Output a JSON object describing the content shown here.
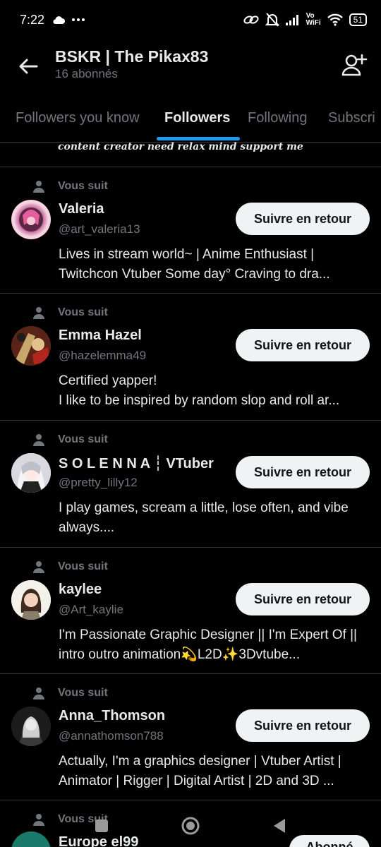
{
  "status_bar": {
    "time": "7:22",
    "vowifi_top": "Vo",
    "vowifi_bottom": "WiFi",
    "battery": "51"
  },
  "header": {
    "title": "BSKR | The Pikax83",
    "subtitle": "16 abonnés"
  },
  "tabs": [
    {
      "label": "Followers you know"
    },
    {
      "label": "Followers"
    },
    {
      "label": "Following"
    },
    {
      "label": "Subscri"
    }
  ],
  "partial_bio": "content creator need relax mind support me",
  "followers": [
    {
      "follows_label": "Vous suit",
      "name": "Valeria",
      "handle": "@art_valeria13",
      "bio": "Lives in stream world~ | Anime Enthusiast | Twitchcon  Vtuber Some day° Craving to dra...",
      "button": "Suivre en retour"
    },
    {
      "follows_label": "Vous suit",
      "name": "Emma Hazel",
      "handle": "@hazelemma49",
      "bio_line1": "Certified yapper!",
      "bio_line2": "I like to be inspired by random slop and roll ar...",
      "button": "Suivre en retour"
    },
    {
      "follows_label": "Vous suit",
      "name": "S O L E N N A ┆ VTuber",
      "handle": "@pretty_lilly12",
      "bio": "I play games, scream a little, lose often, and vibe always....",
      "button": "Suivre en retour"
    },
    {
      "follows_label": "Vous suit",
      "name": "kaylee",
      "handle": "@Art_kaylie",
      "bio": "I'm Passionate Graphic Designer || I'm Expert Of || intro outro animation💫L2D✨3Dvtube...",
      "button": "Suivre en retour"
    },
    {
      "follows_label": "Vous suit",
      "name": "Anna_Thomson",
      "handle": "@annathomson788",
      "bio": "Actually, I'm a graphics designer | Vtuber Artist | Animator |  Rigger | Digital Artist | 2D and 3D ...",
      "button": "Suivre en retour"
    },
    {
      "follows_label": "Vous suit",
      "name": "Europe el99",
      "button": "Abonné"
    }
  ]
}
